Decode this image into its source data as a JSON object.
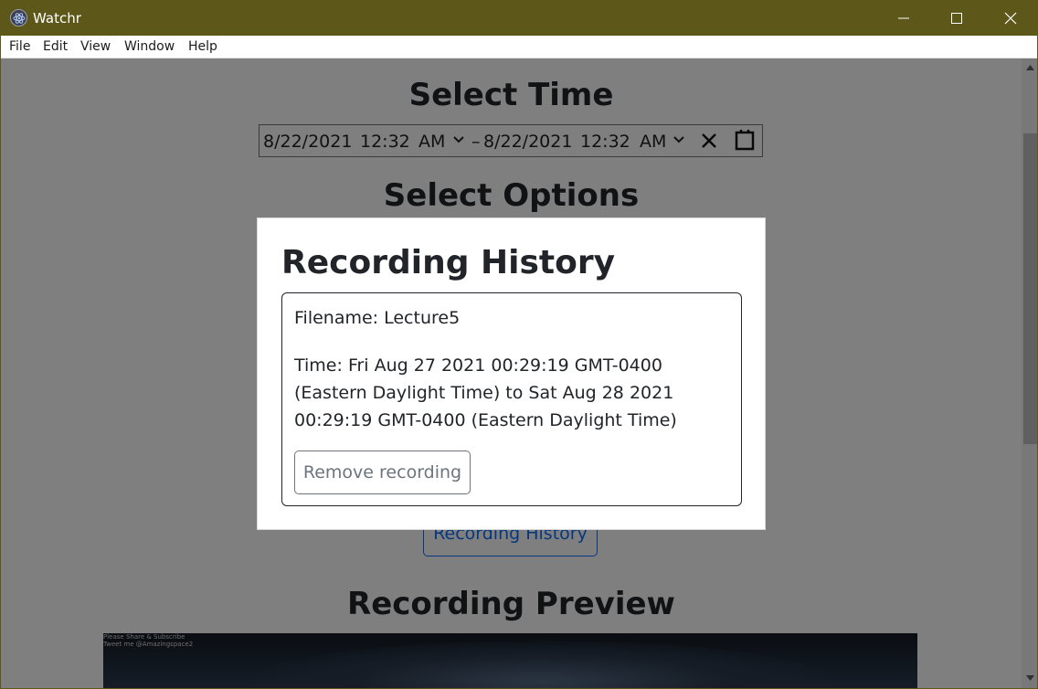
{
  "window": {
    "title": "Watchr"
  },
  "menu": [
    "File",
    "Edit",
    "View",
    "Window",
    "Help"
  ],
  "page": {
    "select_time_heading": "Select Time",
    "select_options_heading": "Select Options",
    "date_range": {
      "start_date": "8/22/2021",
      "start_time": "12:32",
      "start_ampm": "AM",
      "separator": "–",
      "end_date": "8/22/2021",
      "end_time": "12:32",
      "end_ampm": "AM"
    },
    "recording_history_button": "Recording History",
    "recording_preview_heading": "Recording Preview",
    "video_overlay_line1": "Please Share & Subscribe",
    "video_overlay_line2": "Tweet me @Amazingspace2"
  },
  "modal": {
    "title": "Recording History",
    "recordings": [
      {
        "filename_text": "Filename: Lecture5",
        "time_text": "Time: Fri Aug 27 2021 00:29:19 GMT-0400 (Eastern Daylight Time) to Sat Aug 28 2021 00:29:19 GMT-0400 (Eastern Daylight Time)",
        "remove_label": "Remove recording"
      }
    ]
  },
  "colors": {
    "titlebar": "#5e571a",
    "primary": "#0d6efd",
    "secondary": "#6c757d"
  }
}
